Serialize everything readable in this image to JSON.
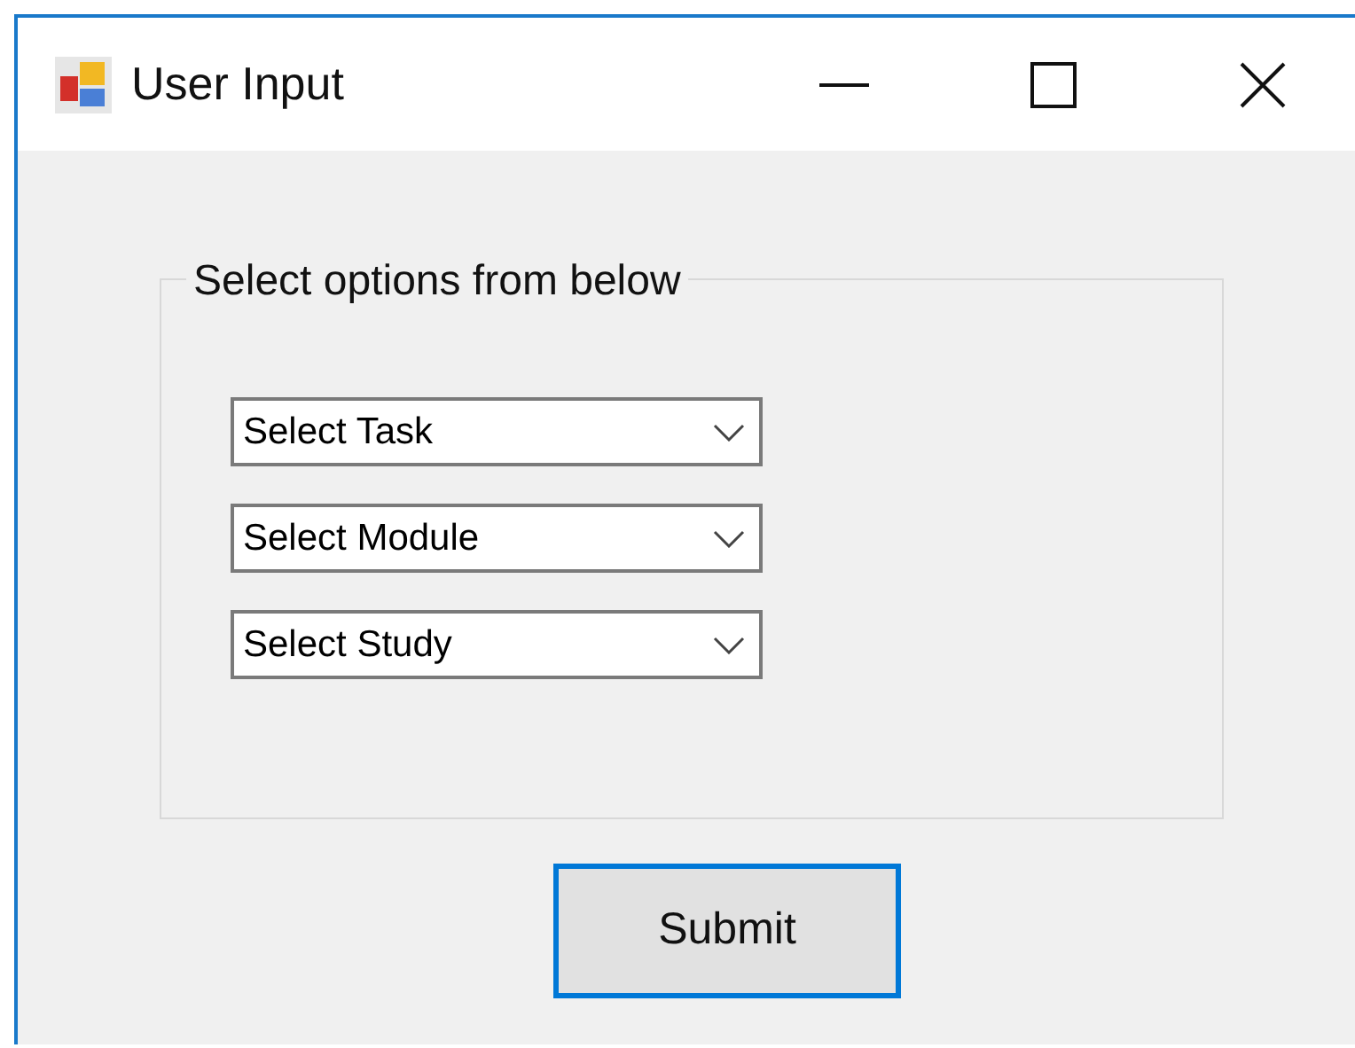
{
  "window": {
    "title": "User Input"
  },
  "group": {
    "legend": "Select options from below",
    "dropdowns": [
      {
        "value": "Select Task"
      },
      {
        "value": "Select Module"
      },
      {
        "value": "Select Study"
      }
    ]
  },
  "submit": {
    "label": "Submit",
    "focused": true
  }
}
